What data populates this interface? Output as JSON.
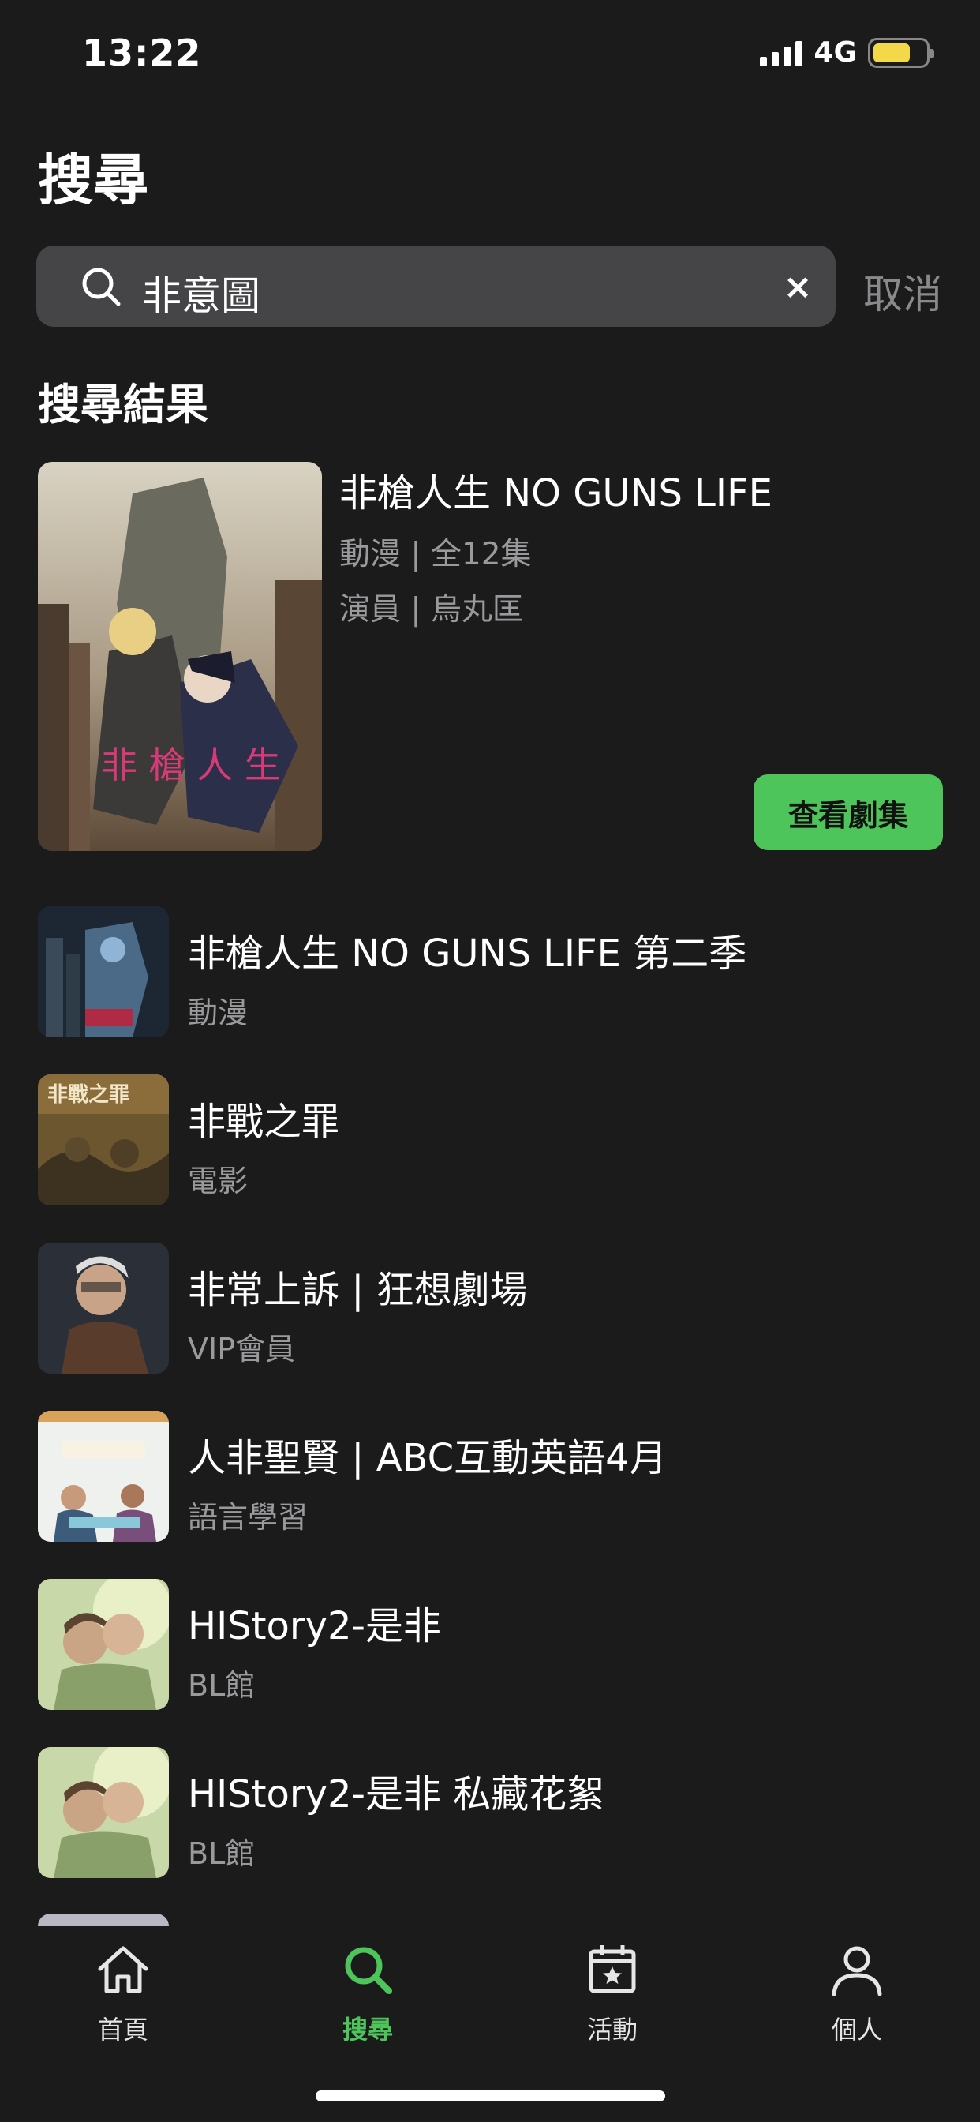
{
  "status_bar": {
    "time": "13:22",
    "network": "4G",
    "battery_level": 0.72
  },
  "page_title": "搜尋",
  "search": {
    "query": "非意圖",
    "clear_label": "×",
    "cancel_label": "取消"
  },
  "results_title": "搜尋結果",
  "featured": {
    "title": "非槍人生 NO GUNS LIFE",
    "meta_line1": "動漫 | 全12集",
    "meta_line2": "演員 | 烏丸匡",
    "button_label": "查看劇集"
  },
  "results": [
    {
      "title": "非槍人生 NO GUNS LIFE 第二季",
      "subtitle": "動漫"
    },
    {
      "title": "非戰之罪",
      "subtitle": "電影"
    },
    {
      "title": "非常上訴 | 狂想劇場",
      "subtitle": "VIP會員"
    },
    {
      "title": "人非聖賢 | ABC互動英語4月",
      "subtitle": "語言學習"
    },
    {
      "title": "HIStory2-是非",
      "subtitle": "BL館"
    },
    {
      "title": "HIStory2-是非 私藏花絮",
      "subtitle": "BL館"
    }
  ],
  "tab_bar": {
    "home": "首頁",
    "search": "搜尋",
    "events": "活動",
    "profile": "個人"
  },
  "colors": {
    "accent": "#4ec55a",
    "background": "#1b1b1c",
    "search_field": "#454547",
    "secondary_text": "#9a9a9c"
  }
}
